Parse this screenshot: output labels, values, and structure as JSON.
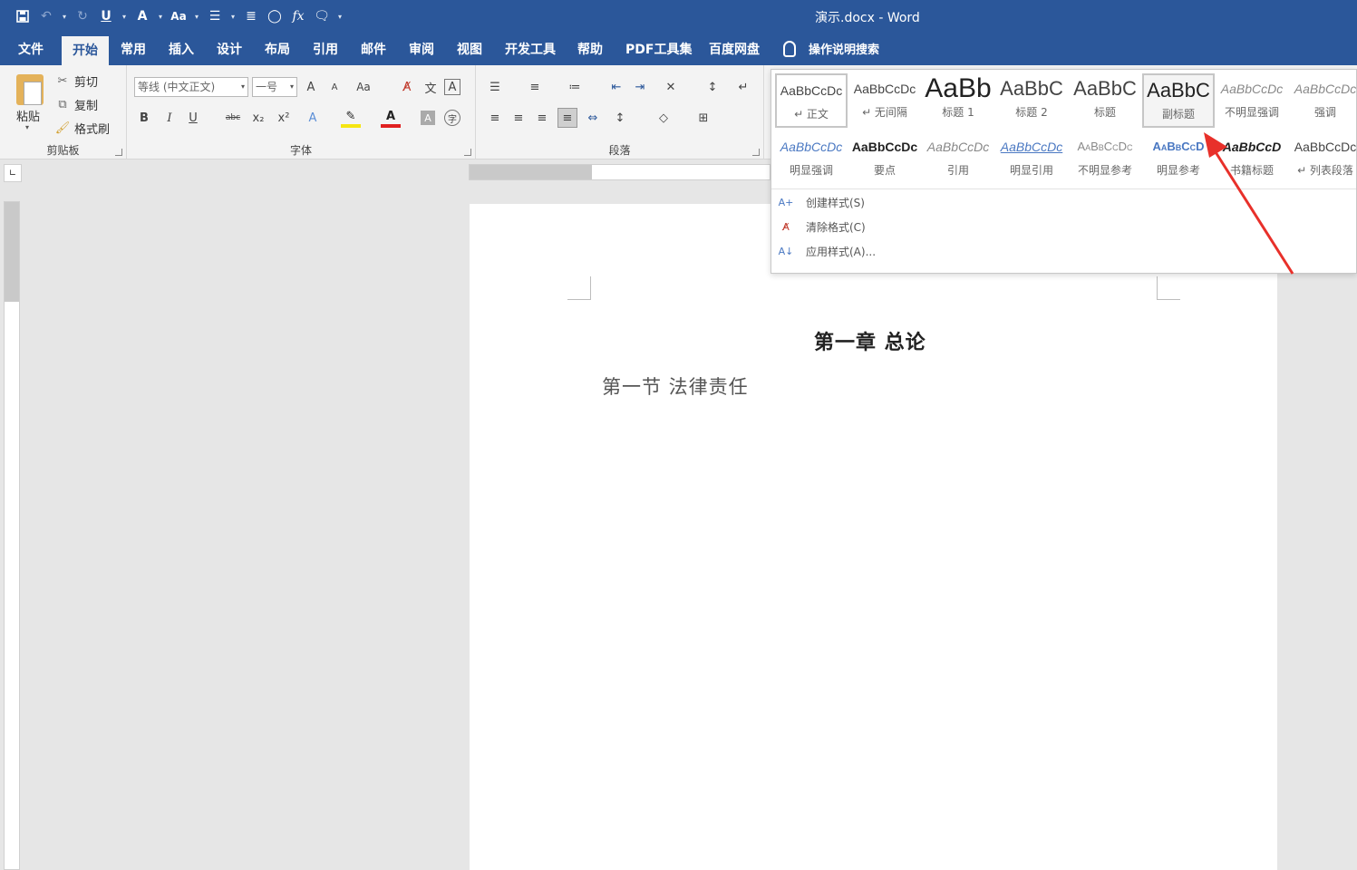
{
  "window": {
    "title": "演示.docx  -  Word"
  },
  "qat": {
    "icons": [
      "save-icon",
      "undo-icon",
      "redo-icon",
      "underline-icon",
      "text-effect-icon",
      "change-case-icon",
      "bullets-icon",
      "align-icon",
      "shape-icon",
      "formula-icon",
      "comment-icon",
      "customize-icon"
    ]
  },
  "tabs": [
    "文件",
    "开始",
    "常用",
    "插入",
    "设计",
    "布局",
    "引用",
    "邮件",
    "审阅",
    "视图",
    "开发工具",
    "帮助",
    "PDF工具集",
    "百度网盘"
  ],
  "tellme": "操作说明搜索",
  "clipboard": {
    "paste": "粘贴",
    "cut": "剪切",
    "copy": "复制",
    "format_painter": "格式刷",
    "label": "剪贴板"
  },
  "font": {
    "name": "等线 (中文正文)",
    "size": "一号",
    "label": "字体",
    "bold": "B",
    "italic": "I",
    "underline": "U",
    "strike": "abc",
    "sub": "x₂",
    "sup": "x²",
    "grow": "A",
    "shrink": "A",
    "case": "Aa"
  },
  "paragraph": {
    "label": "段落"
  },
  "styles": {
    "row1": [
      {
        "sample": "AaBbCcDc",
        "name": "↵ 正文"
      },
      {
        "sample": "AaBbCcDc",
        "name": "↵ 无间隔"
      },
      {
        "sample": "AaBb",
        "name": "标题 1"
      },
      {
        "sample": "AaBbC",
        "name": "标题 2"
      },
      {
        "sample": "AaBbC",
        "name": "标题"
      },
      {
        "sample": "AaBbC",
        "name": "副标题"
      },
      {
        "sample": "AaBbCcDc",
        "name": "不明显强调"
      },
      {
        "sample": "AaBbCcDc",
        "name": "强调"
      }
    ],
    "row2": [
      {
        "sample": "AaBbCcDc",
        "name": "明显强调"
      },
      {
        "sample": "AaBbCcDc",
        "name": "要点"
      },
      {
        "sample": "AaBbCcDc",
        "name": "引用"
      },
      {
        "sample": "AaBbCcDc",
        "name": "明显引用"
      },
      {
        "sample": "AaBbCcDc",
        "name": "不明显参考"
      },
      {
        "sample": "AaBbCcD",
        "name": "明显参考"
      },
      {
        "sample": "AaBbCcD",
        "name": "书籍标题"
      },
      {
        "sample": "AaBbCcDc",
        "name": "↵ 列表段落"
      }
    ],
    "menu": [
      "创建样式(S)",
      "清除格式(C)",
      "应用样式(A)..."
    ]
  },
  "document": {
    "heading1": "第一章  总论",
    "heading2": "第一节  法律责任"
  },
  "colors": {
    "accent": "#2b579a",
    "arrow": "#e8302a"
  }
}
